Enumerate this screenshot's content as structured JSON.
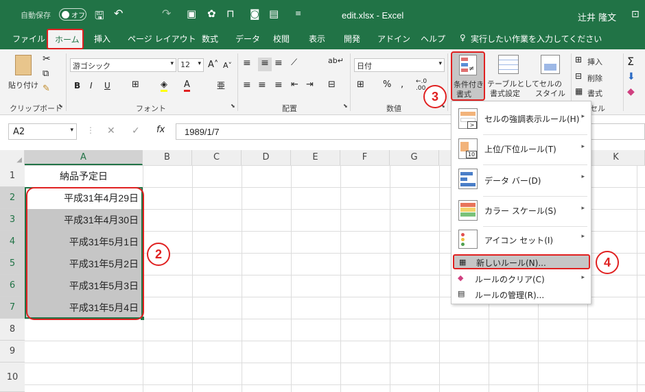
{
  "titlebar": {
    "autosave_label": "自動保存",
    "autosave_state": "オフ",
    "filename": "edit.xlsx - Excel",
    "user": "辻井 隆文"
  },
  "tabs": [
    "ファイル",
    "ホーム",
    "挿入",
    "ページ レイアウト",
    "数式",
    "データ",
    "校閲",
    "表示",
    "開発",
    "アドイン",
    "ヘルプ"
  ],
  "tell_me": "実行したい作業を入力してください",
  "ribbon": {
    "clipboard": {
      "paste": "貼り付け",
      "label": "クリップボード"
    },
    "font": {
      "name": "游ゴシック",
      "size": "12",
      "label": "フォント",
      "bold": "B",
      "italic": "I",
      "underline": "U"
    },
    "alignment": {
      "label": "配置"
    },
    "number": {
      "format": "日付",
      "label": "数値",
      "percent": "%"
    },
    "styles": {
      "conditional": "条件付き",
      "conditional2": "書式",
      "table": "テーブルとして",
      "table2": "書式設定",
      "cell": "セルの",
      "cell2": "スタイル"
    },
    "cells": {
      "insert": "挿入",
      "delete": "削除",
      "format": "書式",
      "label": "セル"
    }
  },
  "formula_bar": {
    "namebox": "A2",
    "fx": "fx",
    "value": "1989/1/7"
  },
  "columns": [
    "A",
    "B",
    "C",
    "D",
    "E",
    "F",
    "G",
    "H",
    "I",
    "J",
    "K"
  ],
  "rows": [
    "1",
    "2",
    "3",
    "4",
    "5",
    "6",
    "7",
    "8",
    "9",
    "10"
  ],
  "cells": {
    "a1": "納品予定日",
    "a2": "平成31年4月29日",
    "a3": "平成31年4月30日",
    "a4": "平成31年5月1日",
    "a5": "平成31年5月2日",
    "a6": "平成31年5月3日",
    "a7": "平成31年5月4日"
  },
  "menu": {
    "highlight": "セルの強調表示ルール(H)",
    "topbottom": "上位/下位ルール(T)",
    "databar": "データ バー(D)",
    "colorscale": "カラー スケール(S)",
    "iconset": "アイコン セット(I)",
    "newrule": "新しいルール(N)...",
    "clear": "ルールのクリア(C)",
    "manage": "ルールの管理(R)..."
  },
  "callouts": {
    "two": "2",
    "three": "3",
    "four": "4"
  },
  "colors": {
    "excel_green": "#217346",
    "red": "#e02020",
    "selection": "#c6c6c6"
  }
}
